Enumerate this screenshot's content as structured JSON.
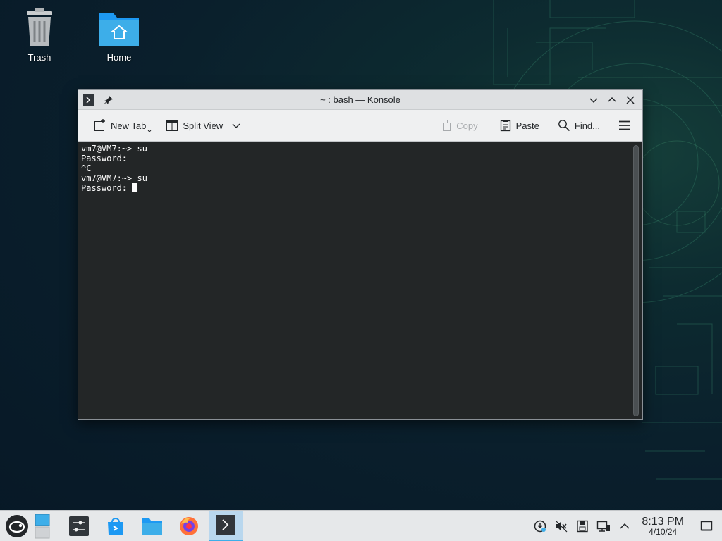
{
  "desktop": {
    "icons": [
      {
        "label": "Trash",
        "icon": "trash-icon"
      },
      {
        "label": "Home",
        "icon": "home-folder-icon"
      }
    ]
  },
  "window": {
    "title": "~ : bash — Konsole",
    "toolbar": {
      "new_tab": "New Tab",
      "split_view": "Split View",
      "copy": "Copy",
      "paste": "Paste",
      "find": "Find..."
    },
    "terminal": {
      "lines": [
        "vm7@VM7:~> su",
        "Password:",
        "^C",
        "vm7@VM7:~> su",
        "Password: "
      ]
    }
  },
  "taskbar": {
    "items": [
      {
        "name": "application-launcher",
        "icon": "opensuse-icon"
      },
      {
        "name": "system-settings",
        "icon": "settings-icon"
      },
      {
        "name": "discover",
        "icon": "discover-icon"
      },
      {
        "name": "file-manager",
        "icon": "folder-icon"
      },
      {
        "name": "firefox",
        "icon": "firefox-icon"
      },
      {
        "name": "konsole",
        "icon": "terminal-icon",
        "active": true
      }
    ],
    "clock": {
      "time": "8:13 PM",
      "date": "4/10/24"
    }
  },
  "colors": {
    "accent": "#3daee9",
    "terminal_bg": "#232627",
    "terminal_fg": "#fcfcfc"
  }
}
